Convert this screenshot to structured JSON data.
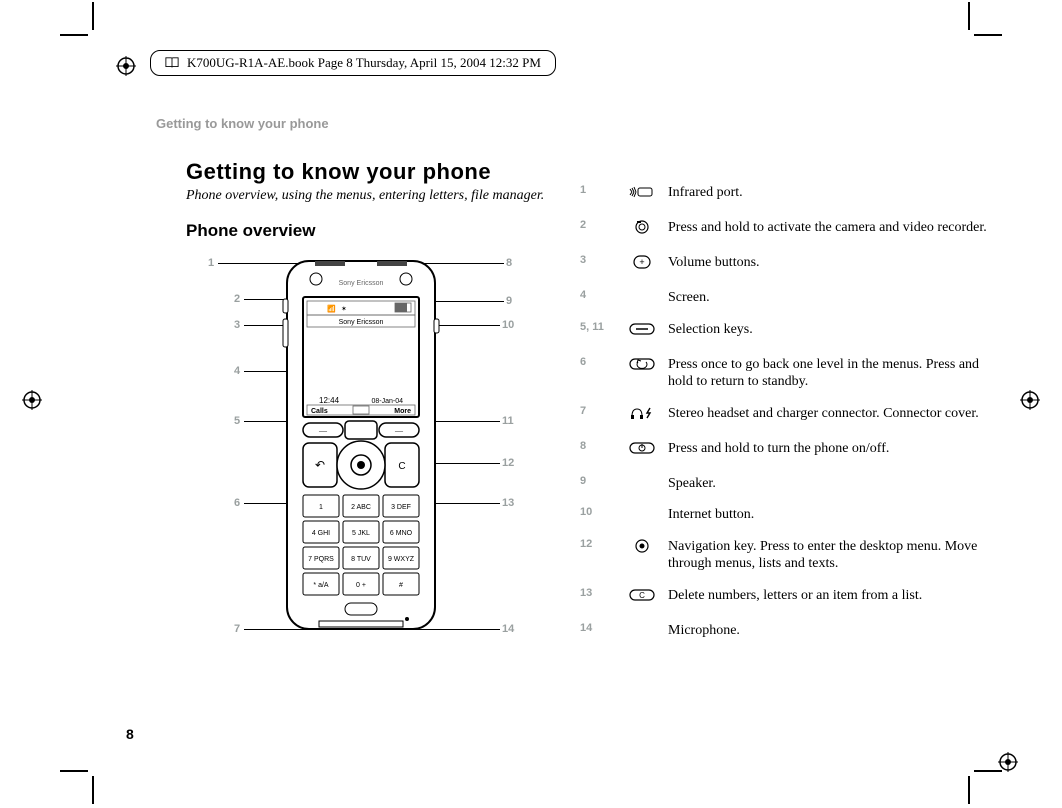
{
  "book_info": "K700UG-R1A-AE.book  Page 8  Thursday, April 15, 2004  12:32 PM",
  "running_header": "Getting to know your phone",
  "title": "Getting to know your phone",
  "subtitle": "Phone overview, using the menus, entering letters, file manager.",
  "section": "Phone overview",
  "page_number": "8",
  "phone_brand": "Sony Ericsson",
  "screen_top": "Sony Ericsson",
  "screen_time": "12:44",
  "screen_date": "08-Jan-04",
  "screen_left": "Calls",
  "screen_right": "More",
  "key_1": "1",
  "key_2": "2 ABC",
  "key_3": "3 DEF",
  "key_4": "4 GHI",
  "key_5": "5 JKL",
  "key_6": "6 MNO",
  "key_7": "7 PQRS",
  "key_8": "8 TUV",
  "key_9": "9 WXYZ",
  "key_star": "* a/A",
  "key_0": "0 +",
  "key_hash": "#",
  "c_left": {
    "n": "1"
  },
  "c_left2": {
    "n": "2"
  },
  "c_left3": {
    "n": "3"
  },
  "c_left4": {
    "n": "4"
  },
  "c_left5": {
    "n": "5"
  },
  "c_left6": {
    "n": "6"
  },
  "c_left7": {
    "n": "7"
  },
  "c_right8": {
    "n": "8"
  },
  "c_right9": {
    "n": "9"
  },
  "c_right10": {
    "n": "10"
  },
  "c_right11": {
    "n": "11"
  },
  "c_right12": {
    "n": "12"
  },
  "c_right13": {
    "n": "13"
  },
  "c_right14": {
    "n": "14"
  },
  "legend": [
    {
      "n": "1",
      "icon": "ir",
      "text": "Infrared port."
    },
    {
      "n": "2",
      "icon": "camera",
      "text": "Press and hold to activate the camera and video recorder."
    },
    {
      "n": "3",
      "icon": "volume",
      "text": "Volume buttons."
    },
    {
      "n": "4",
      "icon": "",
      "text": "Screen."
    },
    {
      "n": "5, 11",
      "icon": "pill",
      "text": "Selection keys."
    },
    {
      "n": "6",
      "icon": "back",
      "text": "Press once to go back one level in the menus. Press and hold to return to standby."
    },
    {
      "n": "7",
      "icon": "headset",
      "text": "Stereo headset and charger connector. Connector cover."
    },
    {
      "n": "8",
      "icon": "power",
      "text": "Press and hold to turn the phone on/off."
    },
    {
      "n": "9",
      "icon": "",
      "text": "Speaker."
    },
    {
      "n": "10",
      "icon": "",
      "text": "Internet button."
    },
    {
      "n": "12",
      "icon": "nav",
      "text": "Navigation key. Press to enter the desktop menu. Move through menus, lists and texts."
    },
    {
      "n": "13",
      "icon": "ckey",
      "text": "Delete numbers, letters or an item from a list."
    },
    {
      "n": "14",
      "icon": "",
      "text": "Microphone."
    }
  ]
}
